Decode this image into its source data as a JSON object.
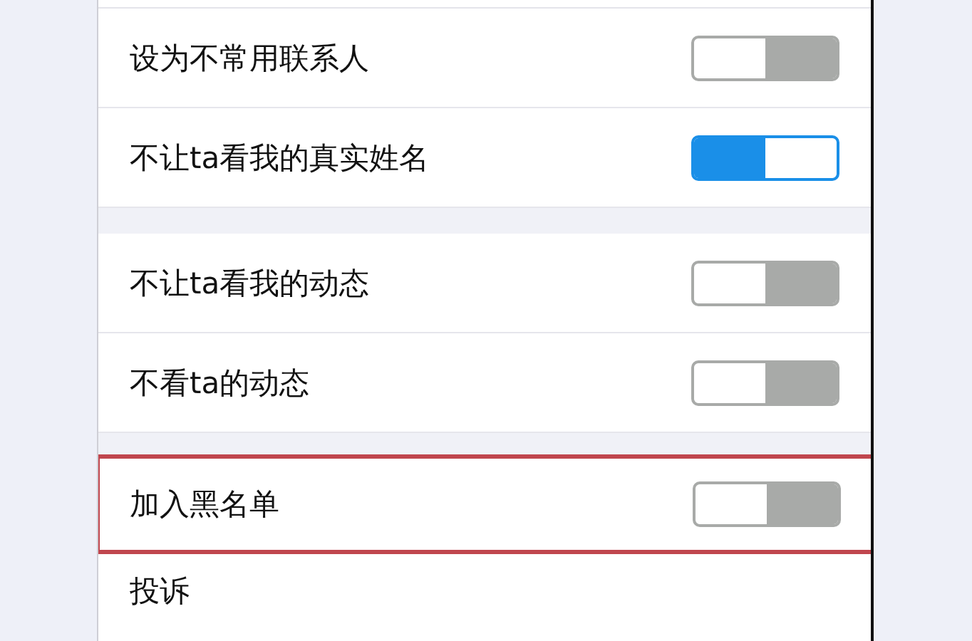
{
  "sections": [
    {
      "items": [
        {
          "kind": "toggle",
          "label": "设为不常用联系人",
          "on": false,
          "highlighted": false
        },
        {
          "kind": "toggle",
          "label": "不让ta看我的真实姓名",
          "on": true,
          "highlighted": false
        }
      ]
    },
    {
      "items": [
        {
          "kind": "toggle",
          "label": "不让ta看我的动态",
          "on": false,
          "highlighted": false
        },
        {
          "kind": "toggle",
          "label": "不看ta的动态",
          "on": false,
          "highlighted": false
        }
      ]
    },
    {
      "items": [
        {
          "kind": "toggle",
          "label": "加入黑名单",
          "on": false,
          "highlighted": true
        },
        {
          "kind": "plain",
          "label": "投诉"
        }
      ]
    }
  ]
}
